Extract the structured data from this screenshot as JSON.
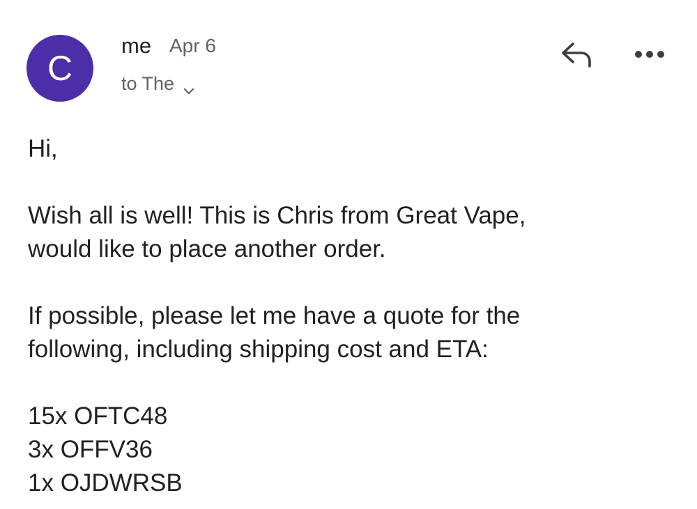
{
  "header": {
    "avatar_letter": "C",
    "avatar_color": "#4a2fa8",
    "sender": "me",
    "date": "Apr 6",
    "recipients": "to The",
    "reply_icon": "reply-icon",
    "more_icon": "more-horizontal-icon"
  },
  "message": {
    "greeting": "Hi,",
    "paragraph1": "Wish all is well! This is Chris from Great Vape,\nwould like to place another order.",
    "paragraph2": "If possible, please let me have a quote for the\nfollowing, including shipping cost and ETA:",
    "items": [
      "15x OFTC48",
      "3x OFFV36",
      "1x OJDWRSB"
    ]
  }
}
